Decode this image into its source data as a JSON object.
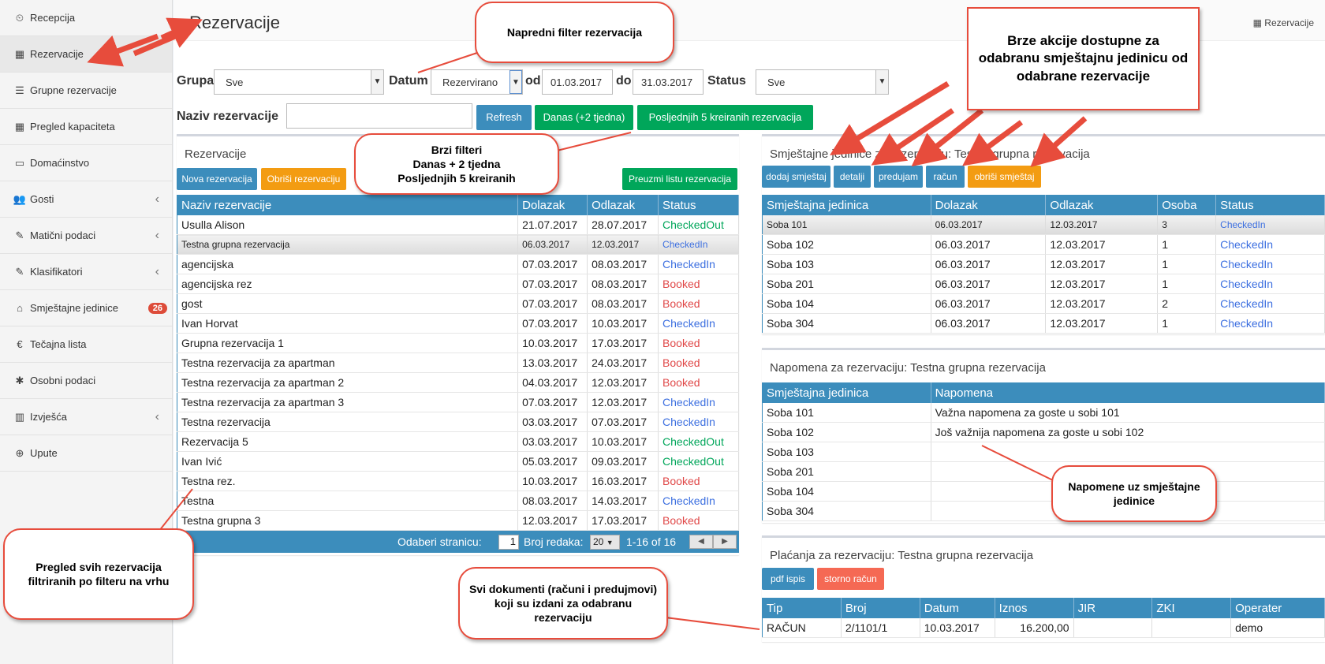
{
  "sidebar": {
    "items": [
      {
        "icon": "dashboard-icon",
        "glyph": "⏲",
        "label": "Recepcija"
      },
      {
        "icon": "grid-icon",
        "glyph": "▦",
        "label": "Rezervacije"
      },
      {
        "icon": "list-icon",
        "glyph": "☰",
        "label": "Grupne rezervacije"
      },
      {
        "icon": "calendar-icon",
        "glyph": "▦",
        "label": "Pregled kapaciteta"
      },
      {
        "icon": "window-icon",
        "glyph": "▭",
        "label": "Domaćinstvo"
      },
      {
        "icon": "users-icon",
        "glyph": "👥",
        "label": "Gosti"
      },
      {
        "icon": "edit-icon",
        "glyph": "✎",
        "label": "Matični podaci"
      },
      {
        "icon": "edit-icon",
        "glyph": "✎",
        "label": "Klasifikatori"
      },
      {
        "icon": "home-icon",
        "glyph": "⌂",
        "label": "Smještajne jedinice",
        "badge": "26"
      },
      {
        "icon": "euro-icon",
        "glyph": "€",
        "label": "Tečajna lista"
      },
      {
        "icon": "asterisk-icon",
        "glyph": "✱",
        "label": "Osobni podaci"
      },
      {
        "icon": "bar-chart-icon",
        "glyph": "▥",
        "label": "Izvješća"
      },
      {
        "icon": "download-icon",
        "glyph": "⊕",
        "label": "Upute"
      }
    ]
  },
  "header": {
    "title": "Rezervacije",
    "breadcrumb": "Rezervacije"
  },
  "filters": {
    "grupa_label": "Grupa",
    "grupa_value": "Sve",
    "datum_label": "Datum",
    "datum_value": "Rezervirano",
    "od_label": "od",
    "od_value": "01.03.2017",
    "do_label": "do",
    "do_value": "31.03.2017",
    "status_label": "Status",
    "status_value": "Sve",
    "naziv_label": "Naziv rezervacije",
    "naziv_value": "",
    "refresh": "Refresh",
    "danas": "Danas (+2 tjedna)",
    "last5": "Posljednjih 5 kreiranih rezervacija"
  },
  "reservations": {
    "title": "Rezervacije",
    "btn_new": "Nova rezervacija",
    "btn_delete": "Obriši rezervaciju",
    "btn_download": "Preuzmi listu rezervacija",
    "columns": [
      "Naziv rezervacije",
      "Dolazak",
      "Odlazak",
      "Status"
    ],
    "rows": [
      {
        "name": "Usulla Alison",
        "in": "21.07.2017",
        "out": "28.07.2017",
        "status": "CheckedOut"
      },
      {
        "name": "Testna grupna rezervacija",
        "in": "06.03.2017",
        "out": "12.03.2017",
        "status": "CheckedIn"
      },
      {
        "name": "agencijska",
        "in": "07.03.2017",
        "out": "08.03.2017",
        "status": "CheckedIn"
      },
      {
        "name": "agencijska rez",
        "in": "07.03.2017",
        "out": "08.03.2017",
        "status": "Booked"
      },
      {
        "name": "gost",
        "in": "07.03.2017",
        "out": "08.03.2017",
        "status": "Booked"
      },
      {
        "name": "Ivan Horvat",
        "in": "07.03.2017",
        "out": "10.03.2017",
        "status": "CheckedIn"
      },
      {
        "name": "Grupna rezervacija 1",
        "in": "10.03.2017",
        "out": "17.03.2017",
        "status": "Booked"
      },
      {
        "name": "Testna rezervacija za apartman",
        "in": "13.03.2017",
        "out": "24.03.2017",
        "status": "Booked"
      },
      {
        "name": "Testna rezervacija za apartman 2",
        "in": "04.03.2017",
        "out": "12.03.2017",
        "status": "Booked"
      },
      {
        "name": "Testna rezervacija za apartman 3",
        "in": "07.03.2017",
        "out": "12.03.2017",
        "status": "CheckedIn"
      },
      {
        "name": "Testna rezervacija",
        "in": "03.03.2017",
        "out": "07.03.2017",
        "status": "CheckedIn"
      },
      {
        "name": "Rezervacija 5",
        "in": "03.03.2017",
        "out": "10.03.2017",
        "status": "CheckedOut"
      },
      {
        "name": "Ivan Ivić",
        "in": "05.03.2017",
        "out": "09.03.2017",
        "status": "CheckedOut"
      },
      {
        "name": "Testna rez.",
        "in": "10.03.2017",
        "out": "16.03.2017",
        "status": "Booked"
      },
      {
        "name": "Testna",
        "in": "08.03.2017",
        "out": "14.03.2017",
        "status": "CheckedIn"
      },
      {
        "name": "Testna grupna 3",
        "in": "12.03.2017",
        "out": "17.03.2017",
        "status": "Booked"
      }
    ],
    "pager": {
      "page_label": "Odaberi stranicu:",
      "page": "1",
      "rows_label": "Broj redaka:",
      "rows": "20",
      "range": "1-16 of 16"
    }
  },
  "units": {
    "title": "Smještajne jedinice za rezervaciju: Testna grupna rezervacija",
    "buttons": [
      "dodaj smještaj",
      "detalji",
      "predujam",
      "račun",
      "obriši smještaj"
    ],
    "columns": [
      "Smještajna jedinica",
      "Dolazak",
      "Odlazak",
      "Osoba",
      "Status"
    ],
    "rows": [
      {
        "unit": "Soba 101",
        "in": "06.03.2017",
        "out": "12.03.2017",
        "persons": "3",
        "status": "CheckedIn"
      },
      {
        "unit": "Soba 102",
        "in": "06.03.2017",
        "out": "12.03.2017",
        "persons": "1",
        "status": "CheckedIn"
      },
      {
        "unit": "Soba 103",
        "in": "06.03.2017",
        "out": "12.03.2017",
        "persons": "1",
        "status": "CheckedIn"
      },
      {
        "unit": "Soba 201",
        "in": "06.03.2017",
        "out": "12.03.2017",
        "persons": "1",
        "status": "CheckedIn"
      },
      {
        "unit": "Soba 104",
        "in": "06.03.2017",
        "out": "12.03.2017",
        "persons": "2",
        "status": "CheckedIn"
      },
      {
        "unit": "Soba 304",
        "in": "06.03.2017",
        "out": "12.03.2017",
        "persons": "1",
        "status": "CheckedIn"
      }
    ]
  },
  "notes": {
    "title": "Napomena za rezervaciju: Testna grupna rezervacija",
    "columns": [
      "Smještajna jedinica",
      "Napomena"
    ],
    "rows": [
      {
        "unit": "Soba 101",
        "note": "Važna napomena za goste u sobi 101"
      },
      {
        "unit": "Soba 102",
        "note": "Još važnija napomena za goste u sobi 102"
      },
      {
        "unit": "Soba 103",
        "note": ""
      },
      {
        "unit": "Soba 201",
        "note": ""
      },
      {
        "unit": "Soba 104",
        "note": ""
      },
      {
        "unit": "Soba 304",
        "note": ""
      }
    ]
  },
  "payments": {
    "title": "Plaćanja za rezervaciju: Testna grupna rezervacija",
    "btn_pdf": "pdf ispis",
    "btn_storno": "storno račun",
    "columns": [
      "Tip",
      "Broj",
      "Datum",
      "Iznos",
      "JIR",
      "ZKI",
      "Operater"
    ],
    "rows": [
      {
        "tip": "RAČUN",
        "broj": "2/1101/1",
        "datum": "10.03.2017",
        "iznos": "16.200,00",
        "jir": "",
        "zki": "",
        "operater": "demo"
      }
    ]
  },
  "callouts": {
    "filter": "Napredni filter rezervacija",
    "quick_actions": "Brze akcije dostupne za odabranu smještajnu jedinicu od odabrane rezervacije",
    "quick_filters": "Brzi filteri\nDanas + 2 tjedna\nPosljednjih 5 kreiranih",
    "notes": "Napomene uz smještajne jedinice",
    "overview": "Pregled svih rezervacija filtriranih po filteru na vrhu",
    "documents": "Svi dokumenti (računi i predujmovi) koji su izdani za odabranu rezervaciju"
  },
  "colors": {
    "primary": "#3c8dbc",
    "success": "#00a65a",
    "warning": "#f39c12",
    "danger": "#f56954",
    "callout_border": "#e74c3c"
  }
}
